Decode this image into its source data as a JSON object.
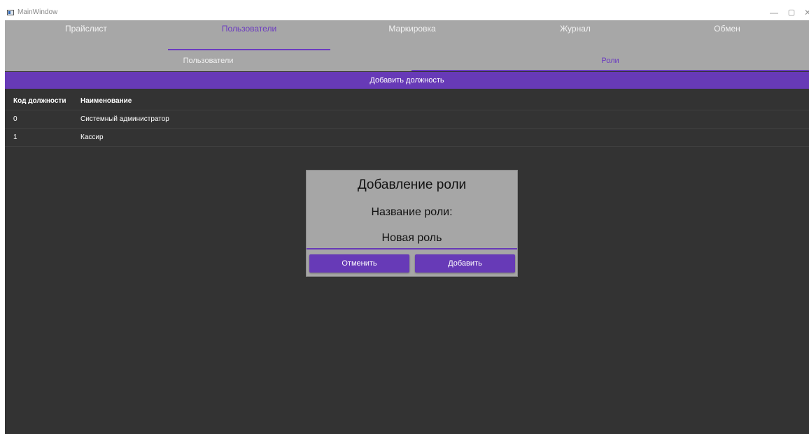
{
  "window": {
    "title": "MainWindow",
    "controls": {
      "minimize": "—",
      "maximize": "▢",
      "close": "✕"
    }
  },
  "main_tabs": [
    {
      "label": "Прайслист",
      "active": false
    },
    {
      "label": "Пользователи",
      "active": true
    },
    {
      "label": "Маркировка",
      "active": false
    },
    {
      "label": "Журнал",
      "active": false
    },
    {
      "label": "Обмен",
      "active": false
    }
  ],
  "sub_tabs": [
    {
      "label": "Пользователи",
      "active": false
    },
    {
      "label": "Роли",
      "active": true
    }
  ],
  "toolbar": {
    "add_position_label": "Добавить должность"
  },
  "table": {
    "columns": [
      "Код должности",
      "Наименование"
    ],
    "rows": [
      {
        "code": "0",
        "name": "Системный администратор"
      },
      {
        "code": "1",
        "name": "Кассир"
      }
    ]
  },
  "dialog": {
    "title": "Добавление роли",
    "field_label": "Название роли:",
    "field_value": "Новая роль",
    "cancel_label": "Отменить",
    "add_label": "Добавить"
  },
  "colors": {
    "accent": "#673ab7",
    "tab_bar": "#a7a7a7",
    "background": "#333333",
    "dialog_bg": "#a6a6a6"
  },
  "icons": {
    "app": "app-window-icon",
    "minimize": "minimize-icon",
    "maximize": "maximize-icon",
    "close": "close-icon"
  }
}
